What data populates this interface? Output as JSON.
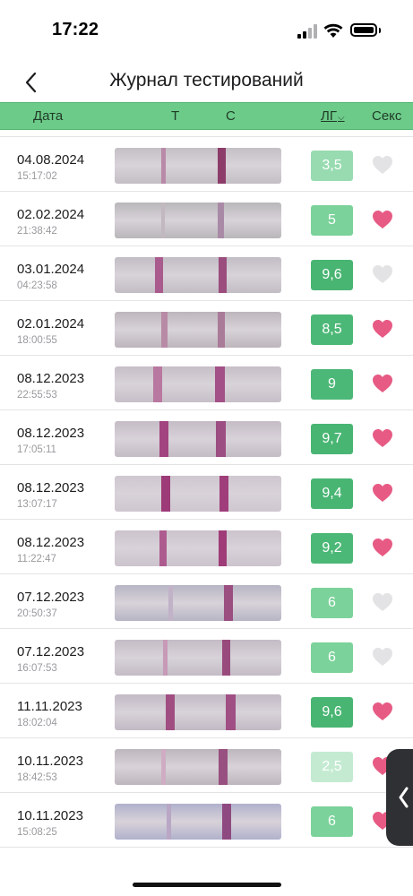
{
  "status": {
    "time": "17:22"
  },
  "nav": {
    "title": "Журнал тестирований"
  },
  "columns": {
    "date": "Дата",
    "t": "Т",
    "c": "С",
    "lh": "ЛГ",
    "sex": "Секс"
  },
  "colors": {
    "header_green": "#6dcb8a",
    "heart_on": "#e75a84",
    "heart_off": "#e3e3e5"
  },
  "rows": [
    {
      "date": "04.08.2024",
      "time": "15:17:02",
      "lh": "3,5",
      "sex": false
    },
    {
      "date": "02.02.2024",
      "time": "21:38:42",
      "lh": "5",
      "sex": true
    },
    {
      "date": "03.01.2024",
      "time": "04:23:58",
      "lh": "9,6",
      "sex": false
    },
    {
      "date": "02.01.2024",
      "time": "18:00:55",
      "lh": "8,5",
      "sex": true
    },
    {
      "date": "08.12.2023",
      "time": "22:55:53",
      "lh": "9",
      "sex": true
    },
    {
      "date": "08.12.2023",
      "time": "17:05:11",
      "lh": "9,7",
      "sex": true
    },
    {
      "date": "08.12.2023",
      "time": "13:07:17",
      "lh": "9,4",
      "sex": true
    },
    {
      "date": "08.12.2023",
      "time": "11:22:47",
      "lh": "9,2",
      "sex": true
    },
    {
      "date": "07.12.2023",
      "time": "20:50:37",
      "lh": "6",
      "sex": false
    },
    {
      "date": "07.12.2023",
      "time": "16:07:53",
      "lh": "6",
      "sex": false
    },
    {
      "date": "11.11.2023",
      "time": "18:02:04",
      "lh": "9,6",
      "sex": true
    },
    {
      "date": "10.11.2023",
      "time": "18:42:53",
      "lh": "2,5",
      "sex": true
    },
    {
      "date": "10.11.2023",
      "time": "15:08:25",
      "lh": "6",
      "sex": true
    }
  ]
}
